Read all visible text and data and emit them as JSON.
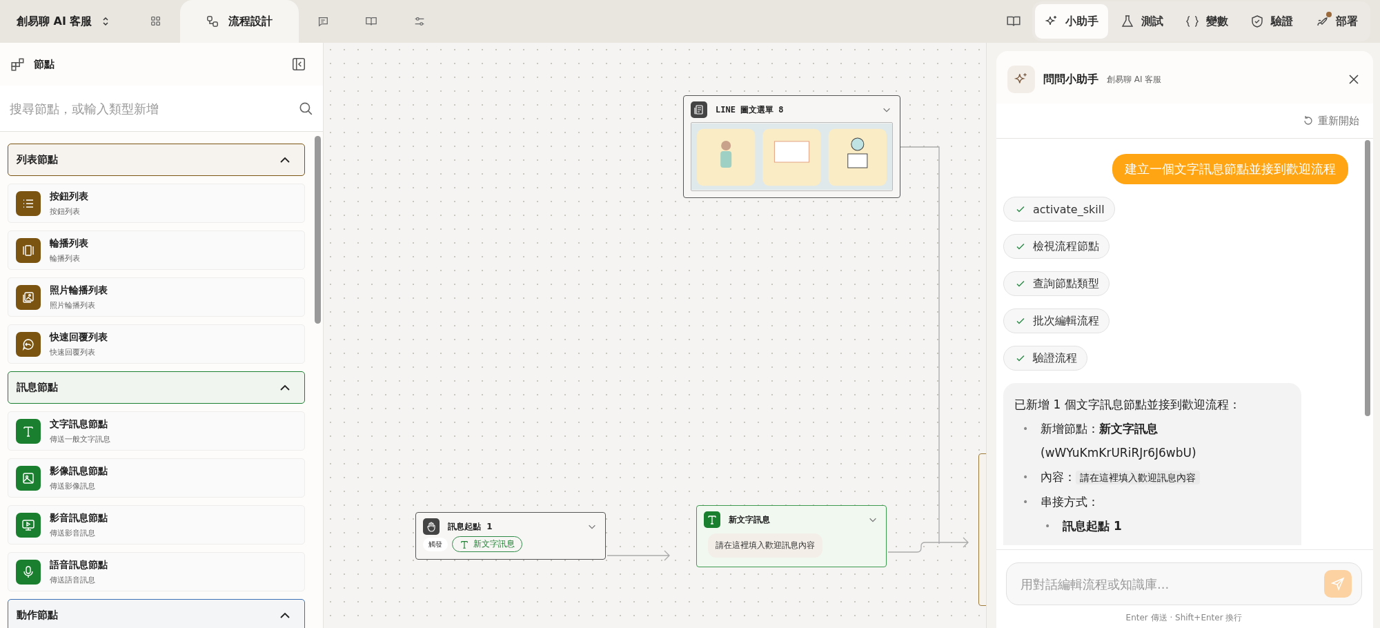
{
  "topbar": {
    "workspace": "創易聊 AI 客服",
    "nav_tabs": [
      {
        "selected": false
      },
      {
        "label": "流程設計",
        "selected": true
      },
      {
        "selected": false
      },
      {
        "selected": false
      },
      {
        "selected": false
      }
    ],
    "tools": [
      {
        "label": "小助手",
        "selected": true,
        "notified": false
      },
      {
        "label": "測試",
        "selected": false,
        "notified": false
      },
      {
        "label": "變數",
        "selected": false,
        "notified": false
      },
      {
        "label": "驗證",
        "selected": false,
        "notified": false
      },
      {
        "label": "部署",
        "selected": false,
        "notified": true
      }
    ]
  },
  "sidebar": {
    "title": "節點",
    "search": {
      "placeholder": "搜尋節點，或輸入類型新增"
    },
    "sections": [
      {
        "title": "列表節點",
        "color": "#7a5410",
        "expanded": true,
        "items": [
          {
            "name": "按鈕列表",
            "desc": "按鈕列表"
          },
          {
            "name": "輪播列表",
            "desc": "輪播列表"
          },
          {
            "name": "照片輪播列表",
            "desc": "照片輪播列表"
          },
          {
            "name": "快速回覆列表",
            "desc": "快速回覆列表"
          }
        ]
      },
      {
        "title": "訊息節點",
        "color": "#1a7f2e",
        "expanded": true,
        "items": [
          {
            "name": "文字訊息節點",
            "desc": "傳送一般文字訊息"
          },
          {
            "name": "影像訊息節點",
            "desc": "傳送影像訊息"
          },
          {
            "name": "影音訊息節點",
            "desc": "傳送影音訊息"
          },
          {
            "name": "語音訊息節點",
            "desc": "傳送語音訊息"
          }
        ]
      },
      {
        "title": "動作節點",
        "color": "#3b6fb6",
        "expanded": true
      }
    ]
  },
  "canvas": {
    "nodes": [
      {
        "kind": "richmenu",
        "title": "LINE 圖文選單 8"
      },
      {
        "kind": "start",
        "title": "訊息起點",
        "count": "1",
        "trigger_label": "觸發",
        "trigger": "新文字訊息"
      },
      {
        "kind": "text",
        "title": "新文字訊息",
        "message": "請在這裡填入歡迎訊息內容"
      },
      {
        "kind": "partial"
      }
    ]
  },
  "assistant": {
    "title": "問問小助手",
    "subtitle": "創易聊 AI 客服",
    "restart": "重新開始",
    "messages": [
      {
        "kind": "user",
        "text": "建立一個文字訊息節點並接到歡迎流程"
      },
      {
        "kind": "tool",
        "text": "activate_skill",
        "done": true
      },
      {
        "kind": "tool",
        "text": "檢視流程節點",
        "done": true
      },
      {
        "kind": "tool",
        "text": "查詢節點類型",
        "done": true
      },
      {
        "kind": "tool",
        "text": "批次編輯流程",
        "done": true
      },
      {
        "kind": "tool",
        "text": "驗證流程",
        "done": true
      },
      {
        "kind": "reply",
        "intro": "已新增 1 個文字訊息節點並接到歡迎流程：",
        "bullets": [
          {
            "marker": "•",
            "text": "新增節點：**新文字訊息** (wWYuKmKrURiRJr6J6wbU)"
          },
          {
            "marker": "•",
            "text": "內容：",
            "code": "請在這裡填入歡迎訊息內容"
          },
          {
            "marker": "•",
            "text": "串接方式：",
            "children": [
              {
                "marker": "•",
                "text": "**訊息起點 1**"
              }
            ]
          }
        ]
      }
    ],
    "input": {
      "placeholder": "用對話編輯流程或知識庫..."
    },
    "hint": "Enter 傳送 · Shift+Enter 換行"
  }
}
